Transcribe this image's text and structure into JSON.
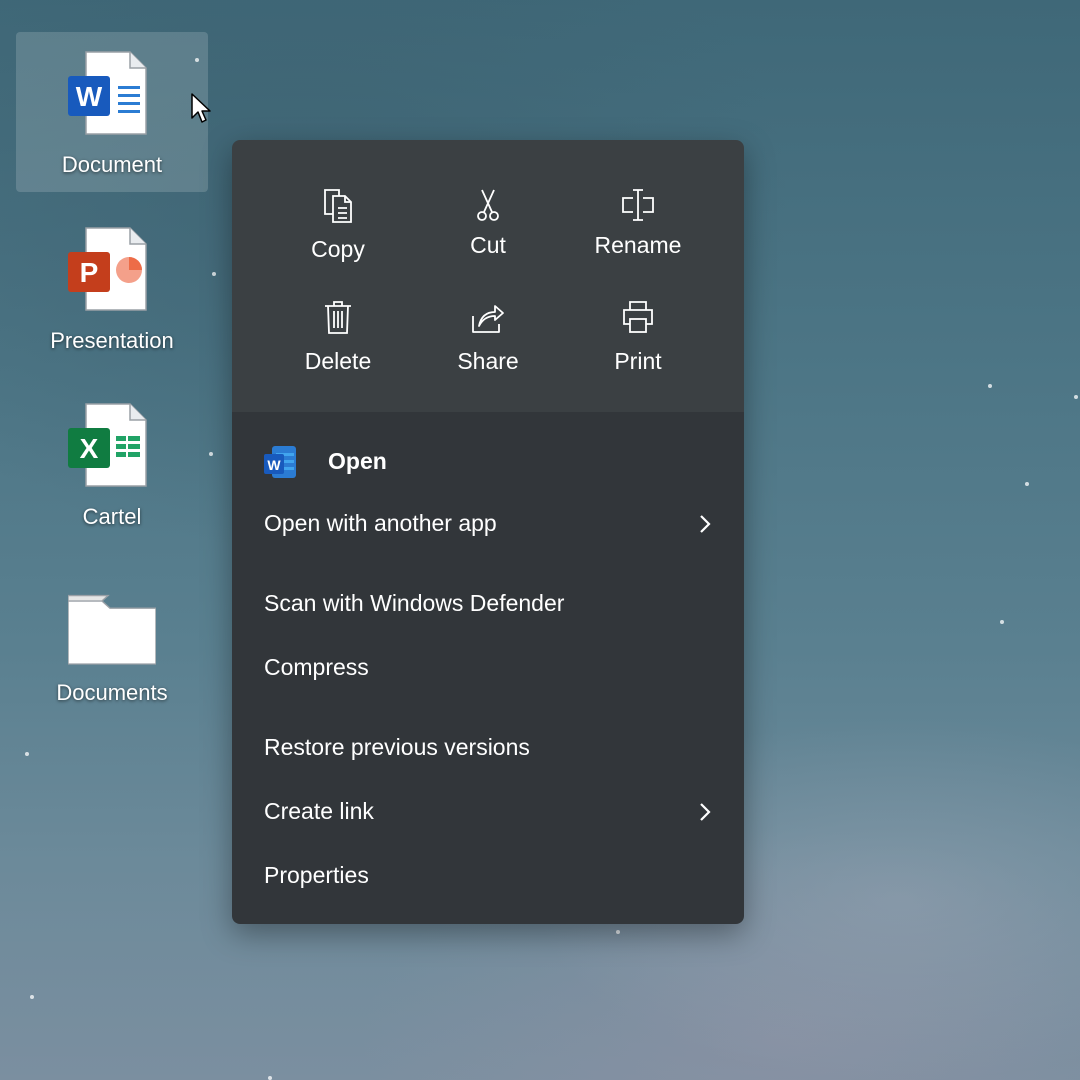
{
  "desktop": {
    "icons": [
      {
        "name": "Document",
        "selected": true
      },
      {
        "name": "Presentation",
        "selected": false
      },
      {
        "name": "Cartel",
        "selected": false
      },
      {
        "name": "Documents",
        "selected": false
      }
    ]
  },
  "context_menu": {
    "actions": [
      {
        "label": "Copy",
        "icon": "copy-icon"
      },
      {
        "label": "Cut",
        "icon": "scissors-icon"
      },
      {
        "label": "Rename",
        "icon": "rename-icon"
      },
      {
        "label": "Delete",
        "icon": "trash-icon"
      },
      {
        "label": "Share",
        "icon": "share-icon"
      },
      {
        "label": "Print",
        "icon": "printer-icon"
      }
    ],
    "items": [
      {
        "label": "Open",
        "icon": "word-icon"
      },
      {
        "label": "Open with another app",
        "submenu": true
      },
      {
        "label": "Scan with Windows Defender"
      },
      {
        "label": "Compress"
      },
      {
        "label": "Restore previous versions"
      },
      {
        "label": "Create link",
        "submenu": true
      },
      {
        "label": "Properties"
      }
    ]
  },
  "colors": {
    "menu_top": "#3b4043",
    "menu_bottom": "#32363a",
    "word_blue": "#185abd",
    "powerpoint_orange": "#c43e1c",
    "excel_green": "#107c41"
  }
}
